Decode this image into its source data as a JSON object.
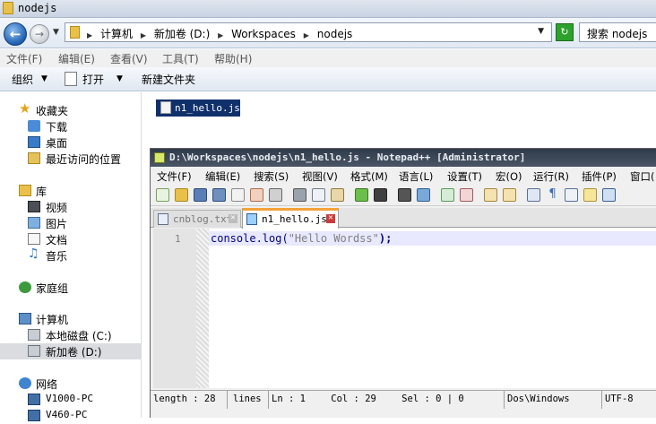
{
  "explorer": {
    "title": "nodejs",
    "address": {
      "crumbs": [
        "计算机",
        "新加卷 (D:)",
        "Workspaces",
        "nodejs"
      ],
      "search_placeholder": "搜索 nodejs"
    },
    "menu": [
      "文件(F)",
      "编辑(E)",
      "查看(V)",
      "工具(T)",
      "帮助(H)"
    ],
    "commands": {
      "organize": "组织",
      "open": "打开",
      "new_folder": "新建文件夹"
    },
    "sidebar": {
      "favorites": {
        "label": "收藏夹",
        "items": [
          "下载",
          "桌面",
          "最近访问的位置"
        ]
      },
      "libraries": {
        "label": "库",
        "items": [
          "视频",
          "图片",
          "文档",
          "音乐"
        ]
      },
      "homegroup": "家庭组",
      "computer": {
        "label": "计算机",
        "items": [
          "本地磁盘 (C:)",
          "新加卷 (D:)"
        ]
      },
      "network": {
        "label": "网络",
        "items": [
          "V1000-PC",
          "V460-PC"
        ]
      }
    },
    "files": [
      "n1_hello.js"
    ]
  },
  "notepad": {
    "title": "D:\\Workspaces\\nodejs\\n1_hello.js - Notepad++ [Administrator]",
    "menu": [
      "文件(F)",
      "编辑(E)",
      "搜索(S)",
      "视图(V)",
      "格式(M)",
      "语言(L)",
      "设置(T)",
      "宏(O)",
      "运行(R)",
      "插件(P)",
      "窗口("
    ],
    "tabs": [
      {
        "label": "cnblog.txt",
        "active": false
      },
      {
        "label": "n1_hello.js",
        "active": true
      }
    ],
    "editor": {
      "line_number": "1",
      "code_prefix": "console.log(",
      "code_string": "\"Hello Wordss\"",
      "code_suffix": ");"
    },
    "status": {
      "length": "length : 28",
      "lines": "lines",
      "ln": "Ln : 1",
      "col": "Col : 29",
      "sel": "Sel : 0 | 0",
      "eol": "Dos\\Windows",
      "encoding": "UTF-8"
    }
  }
}
